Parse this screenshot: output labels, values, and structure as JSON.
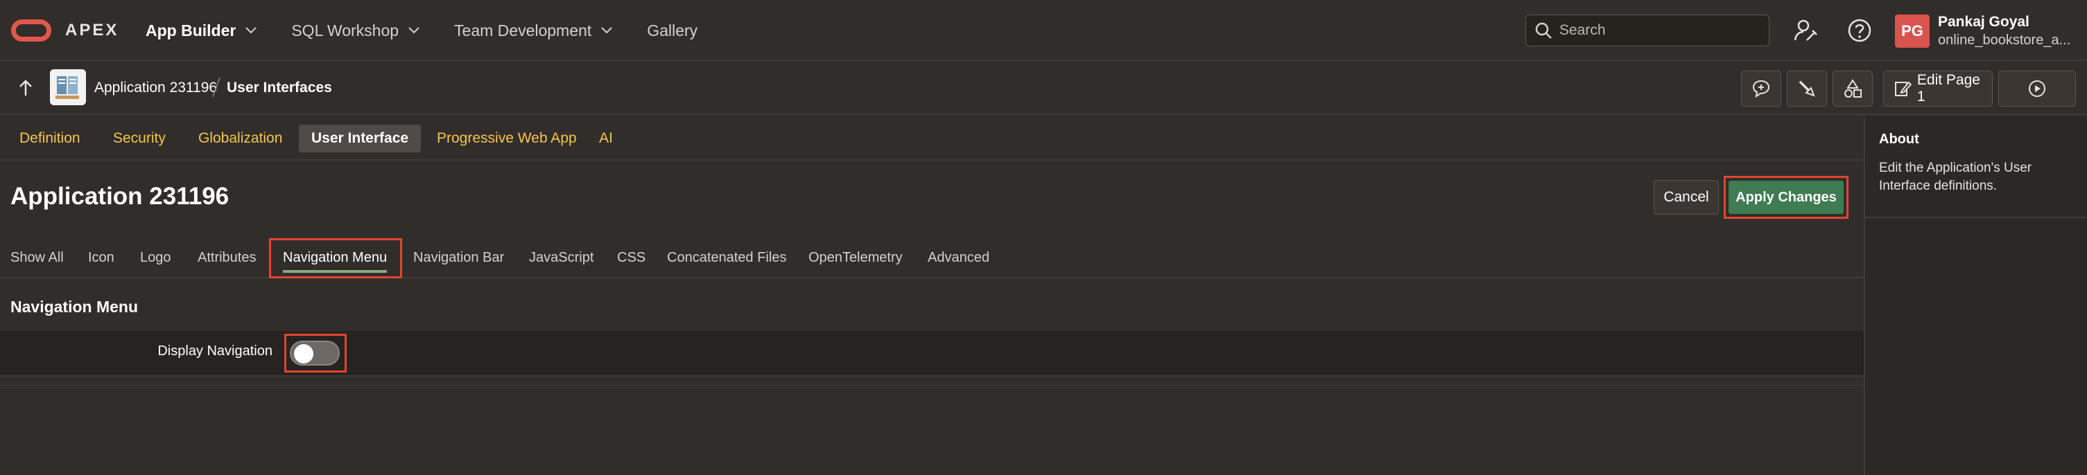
{
  "header": {
    "brand": "APEX",
    "nav": [
      {
        "label": "App Builder",
        "active": true,
        "dropdown": true
      },
      {
        "label": "SQL Workshop",
        "active": false,
        "dropdown": true
      },
      {
        "label": "Team Development",
        "active": false,
        "dropdown": true
      },
      {
        "label": "Gallery",
        "active": false,
        "dropdown": false
      }
    ],
    "search_placeholder": "Search",
    "user": {
      "initials": "PG",
      "name": "Pankaj Goyal",
      "app": "online_bookstore_a..."
    }
  },
  "breadcrumb": {
    "app": "Application 231196",
    "current": "User Interfaces",
    "edit_page_label": "Edit Page 1"
  },
  "section_tabs": [
    {
      "label": "Definition",
      "active": false
    },
    {
      "label": "Security",
      "active": false
    },
    {
      "label": "Globalization",
      "active": false
    },
    {
      "label": "User Interface",
      "active": true
    },
    {
      "label": "Progressive Web App",
      "active": false
    },
    {
      "label": "AI",
      "active": false
    }
  ],
  "page": {
    "title": "Application 231196",
    "cancel_label": "Cancel",
    "apply_label": "Apply Changes"
  },
  "sub_tabs": [
    {
      "label": "Show All",
      "active": false
    },
    {
      "label": "Icon",
      "active": false
    },
    {
      "label": "Logo",
      "active": false
    },
    {
      "label": "Attributes",
      "active": false
    },
    {
      "label": "Navigation Menu",
      "active": true
    },
    {
      "label": "Navigation Bar",
      "active": false
    },
    {
      "label": "JavaScript",
      "active": false
    },
    {
      "label": "CSS",
      "active": false
    },
    {
      "label": "Concatenated Files",
      "active": false
    },
    {
      "label": "OpenTelemetry",
      "active": false
    },
    {
      "label": "Advanced",
      "active": false
    }
  ],
  "region": {
    "title": "Navigation Menu",
    "field_label": "Display Navigation",
    "display_navigation_on": false
  },
  "aside": {
    "title": "About",
    "text": "Edit the Application's User Interface definitions."
  },
  "colors": {
    "accent_tab": "#f5c64c",
    "apply_button": "#3f7b53",
    "highlight_frame": "#e0462f",
    "avatar": "#d9534f"
  }
}
